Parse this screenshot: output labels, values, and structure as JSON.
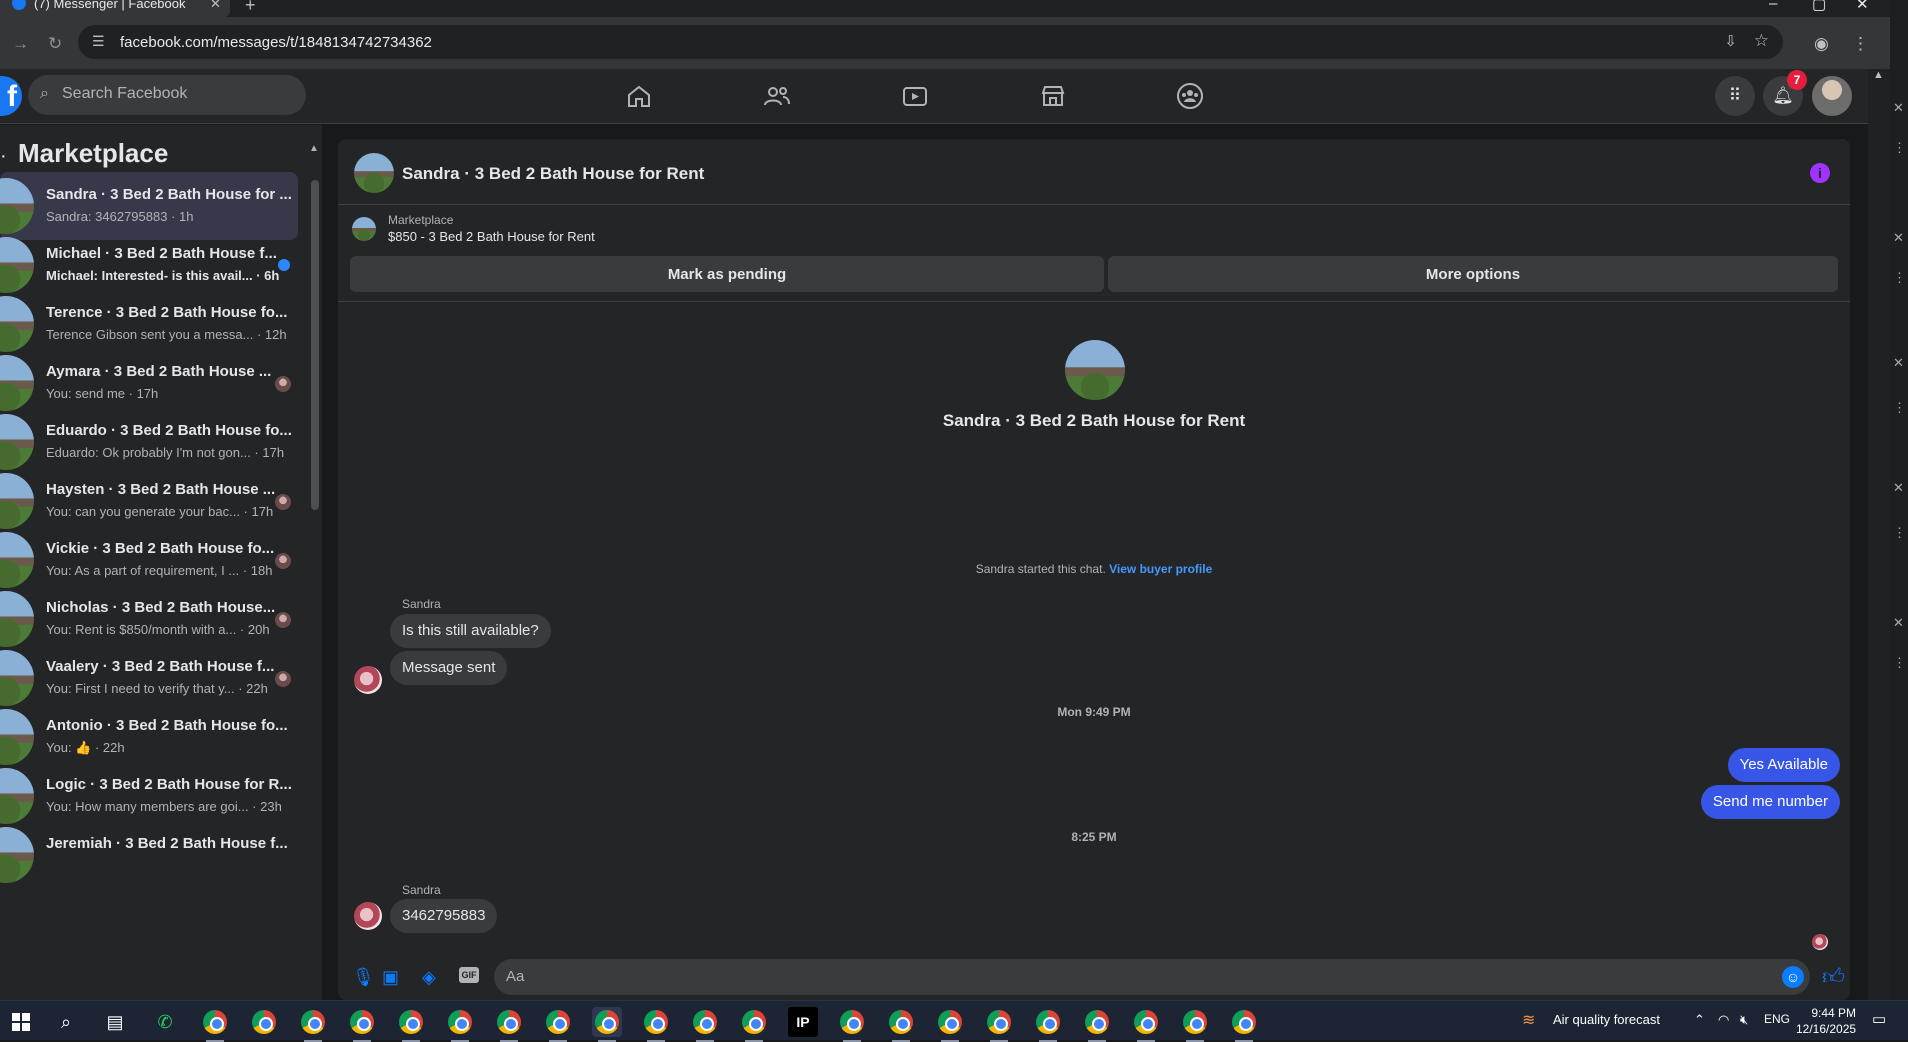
{
  "browser": {
    "tab_title": "(7) Messenger | Facebook",
    "url": "facebook.com/messages/t/1848134742734362"
  },
  "fb": {
    "search_placeholder": "Search Facebook",
    "notification_count": "7"
  },
  "sidebar": {
    "heading": "Marketplace",
    "conversations": [
      {
        "name": "Sandra · 3 Bed 2 Bath House for ...",
        "preview": "Sandra: 3462795883 · 1h",
        "active": true
      },
      {
        "name": "Michael · 3 Bed 2 Bath House f...",
        "preview": "Michael: Interested- is this avail... · 6h",
        "unread": true
      },
      {
        "name": "Terence · 3 Bed 2 Bath House fo...",
        "preview": "Terence Gibson sent you a messa... · 12h"
      },
      {
        "name": "Aymara · 3 Bed 2 Bath House ...",
        "preview": "You: send me · 17h",
        "seen": true
      },
      {
        "name": "Eduardo · 3 Bed 2 Bath House fo...",
        "preview": "Eduardo: Ok probably I'm not gon... · 17h"
      },
      {
        "name": "Haysten · 3 Bed 2 Bath House ...",
        "preview": "You: can you generate your bac... · 17h",
        "seen": true
      },
      {
        "name": "Vickie · 3 Bed 2 Bath House fo...",
        "preview": "You: As a part of requirement, I ... · 18h",
        "seen": true
      },
      {
        "name": "Nicholas · 3 Bed 2 Bath House...",
        "preview": "You: Rent is $850/month with a... · 20h",
        "seen": true
      },
      {
        "name": "Vaalery · 3 Bed 2 Bath House f...",
        "preview": "You: First I need to verify that y... · 22h",
        "seen": true
      },
      {
        "name": "Antonio · 3 Bed 2 Bath House fo...",
        "preview": "You: 👍 · 22h"
      },
      {
        "name": "Logic · 3 Bed 2 Bath House for R...",
        "preview": "You: How many members are goi... · 23h"
      },
      {
        "name": "Jeremiah · 3 Bed 2 Bath House f...",
        "preview": ""
      }
    ]
  },
  "chat": {
    "title": "Sandra · 3 Bed 2 Bath House for Rent",
    "marketplace_label": "Marketplace",
    "listing": "$850 - 3 Bed 2 Bath House for Rent",
    "mark_pending": "Mark as pending",
    "more_options": "More options",
    "started_text": "Sandra started this chat.",
    "view_profile": "View buyer profile",
    "sender_name": "Sandra",
    "msg1": "Is this still available?",
    "msg2": "Message sent",
    "ts1": "Mon 9:49 PM",
    "out1": "Yes Available",
    "out2": "Send me number",
    "ts2": "8:25 PM",
    "msg3": "3462795883",
    "composer_placeholder": "Aa"
  },
  "taskbar": {
    "weather": "Air quality forecast",
    "lang": "ENG",
    "time": "9:44 PM",
    "date": "12/16/2025"
  }
}
